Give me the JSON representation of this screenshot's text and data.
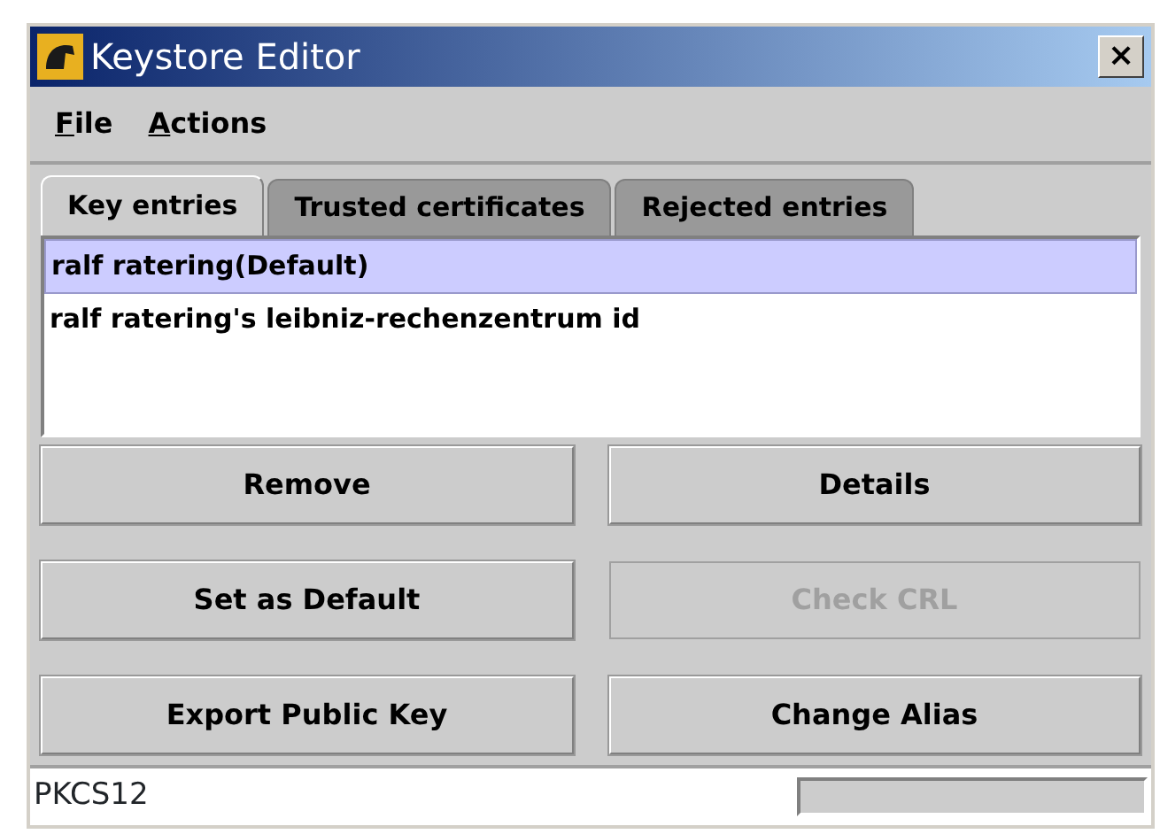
{
  "window": {
    "title": "Keystore Editor",
    "close": "×"
  },
  "menu": [
    {
      "label": "File",
      "mnemonic_underline": true
    },
    {
      "label": "Actions",
      "mnemonic_underline": true
    }
  ],
  "tabs": [
    {
      "label": "Key entries",
      "selected": true
    },
    {
      "label": "Trusted certificates",
      "selected": false
    },
    {
      "label": "Rejected entries",
      "selected": false
    }
  ],
  "entries": [
    {
      "label": "ralf ratering(Default)",
      "selected": true
    },
    {
      "label": "ralf ratering's leibniz-rechenzentrum id",
      "selected": false
    }
  ],
  "buttons": [
    {
      "label": "Remove",
      "disabled": false
    },
    {
      "label": "Details",
      "disabled": false
    },
    {
      "label": "Set as Default",
      "disabled": false
    },
    {
      "label": "Check CRL",
      "disabled": true
    },
    {
      "label": "Export Public Key",
      "disabled": false
    },
    {
      "label": "Change Alias",
      "disabled": false
    }
  ],
  "status_bar": {
    "text": "PKCS12",
    "progress": {
      "level": 0
    }
  }
}
